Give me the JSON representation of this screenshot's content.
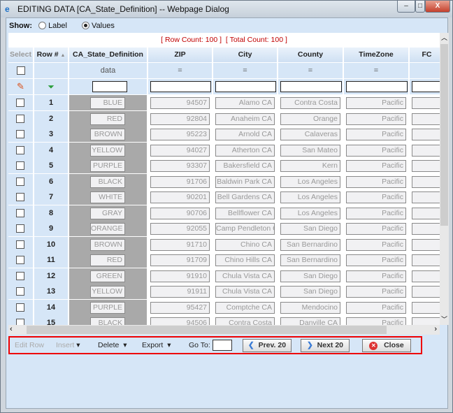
{
  "window": {
    "title": "EDITING DATA [CA_State_Definition] -- Webpage Dialog"
  },
  "show": {
    "label": "Show:",
    "options": [
      {
        "label": "Label",
        "selected": false
      },
      {
        "label": "Values",
        "selected": true
      }
    ]
  },
  "counts": {
    "row_count": "[ Row Count: 100 ]",
    "total_count": "[ Total Count: 100 ]"
  },
  "columns": [
    "Select",
    "Row #",
    "CA_State_Definition",
    "ZIP",
    "City",
    "County",
    "TimeZone",
    "FC"
  ],
  "sort_indicator": "▲",
  "subheader": {
    "CA_State_Definition": "data",
    "ZIP": "=",
    "City": "=",
    "County": "=",
    "TimeZone": "="
  },
  "rows": [
    {
      "n": "1",
      "def": "BLUE",
      "zip": "94507",
      "city": "Alamo CA",
      "county": "Contra Costa",
      "tz": "Pacific"
    },
    {
      "n": "2",
      "def": "RED",
      "zip": "92804",
      "city": "Anaheim CA",
      "county": "Orange",
      "tz": "Pacific"
    },
    {
      "n": "3",
      "def": "BROWN",
      "zip": "95223",
      "city": "Arnold CA",
      "county": "Calaveras",
      "tz": "Pacific"
    },
    {
      "n": "4",
      "def": "YELLOW",
      "zip": "94027",
      "city": "Atherton CA",
      "county": "San Mateo",
      "tz": "Pacific"
    },
    {
      "n": "5",
      "def": "PURPLE",
      "zip": "93307",
      "city": "Bakersfield CA",
      "county": "Kern",
      "tz": "Pacific"
    },
    {
      "n": "6",
      "def": "BLACK",
      "zip": "91706",
      "city": "Baldwin Park CA",
      "county": "Los Angeles",
      "tz": "Pacific"
    },
    {
      "n": "7",
      "def": "WHITE",
      "zip": "90201",
      "city": "Bell Gardens CA",
      "county": "Los Angeles",
      "tz": "Pacific"
    },
    {
      "n": "8",
      "def": "GRAY",
      "zip": "90706",
      "city": "Bellflower CA",
      "county": "Los Angeles",
      "tz": "Pacific"
    },
    {
      "n": "9",
      "def": "ORANGE",
      "zip": "92055",
      "city": "Camp Pendleton CA",
      "county": "San Diego",
      "tz": "Pacific"
    },
    {
      "n": "10",
      "def": "BROWN",
      "zip": "91710",
      "city": "Chino CA",
      "county": "San Bernardino",
      "tz": "Pacific"
    },
    {
      "n": "11",
      "def": "RED",
      "zip": "91709",
      "city": "Chino Hills CA",
      "county": "San Bernardino",
      "tz": "Pacific"
    },
    {
      "n": "12",
      "def": "GREEN",
      "zip": "91910",
      "city": "Chula Vista CA",
      "county": "San Diego",
      "tz": "Pacific"
    },
    {
      "n": "13",
      "def": "YELLOW",
      "zip": "91911",
      "city": "Chula Vista CA",
      "county": "San Diego",
      "tz": "Pacific"
    },
    {
      "n": "14",
      "def": "PURPLE",
      "zip": "95427",
      "city": "Comptche CA",
      "county": "Mendocino",
      "tz": "Pacific"
    },
    {
      "n": "15",
      "def": "BLACK",
      "zip": "94506",
      "city": "Contra Costa",
      "county": "Danville CA",
      "tz": "Pacific"
    }
  ],
  "toolbar": {
    "edit_row": "Edit Row",
    "insert": "Insert",
    "delete": "Delete",
    "export": "Export",
    "goto": "Go To:",
    "goto_value": "",
    "prev": "Prev. 20",
    "next": "Next 20",
    "close": "Close"
  },
  "colors": {
    "accent": "#e00000",
    "header_bg": "#d6e6f7"
  }
}
